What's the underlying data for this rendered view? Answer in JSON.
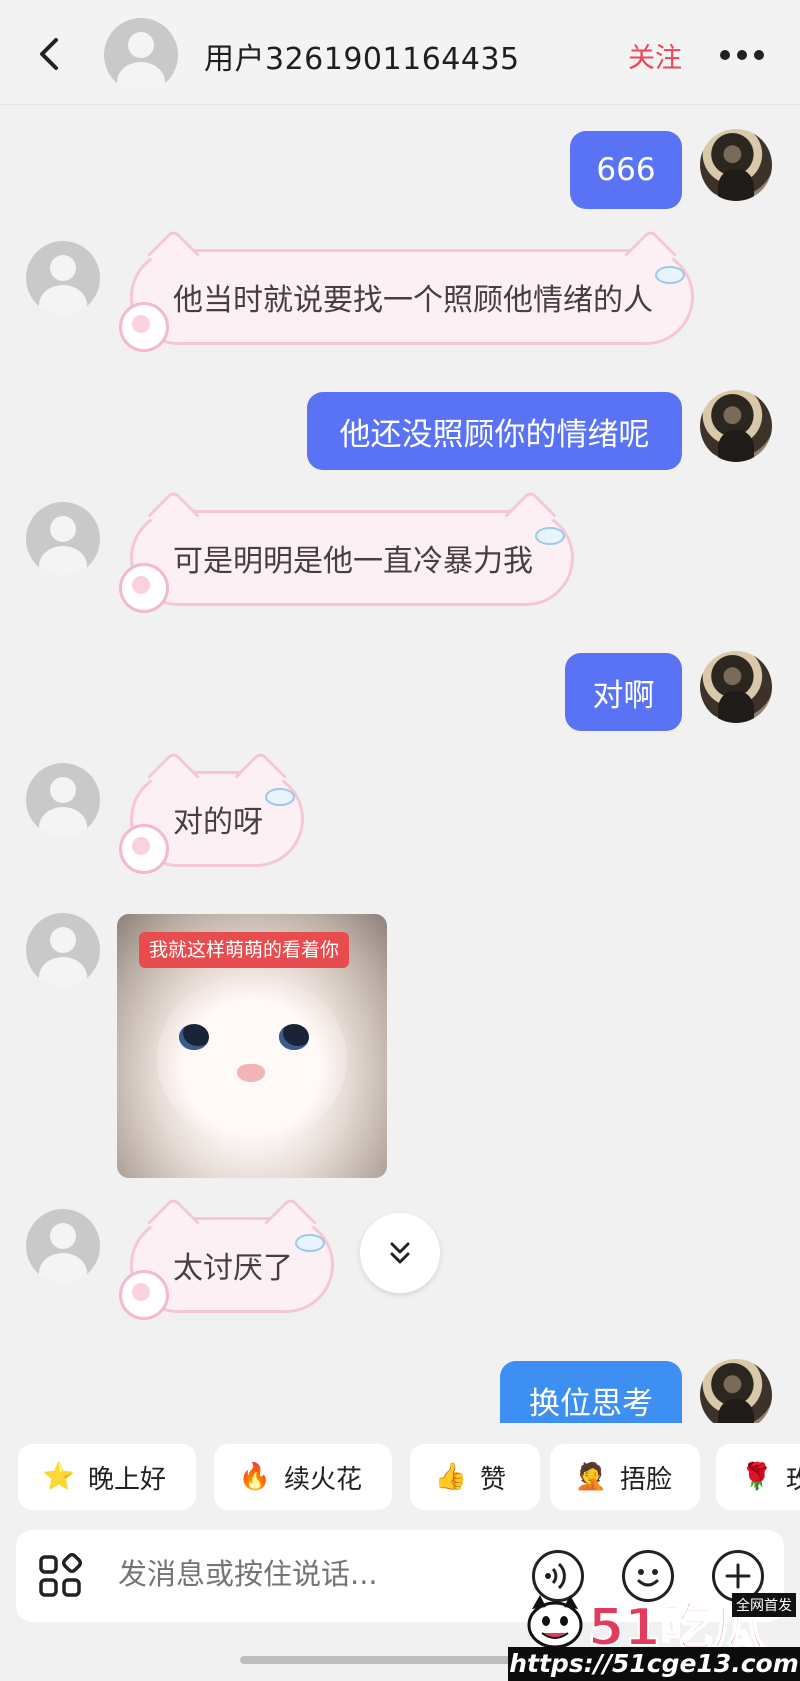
{
  "header": {
    "back_icon": "chevron-left-icon",
    "user_name": "用户3261901164435",
    "follow_label": "关注",
    "more_icon": "more-dots-icon"
  },
  "messages": [
    {
      "side": "self",
      "type": "text",
      "text": "666"
    },
    {
      "side": "other",
      "type": "text",
      "text": "他当时就说要找一个照顾他情绪的人"
    },
    {
      "side": "self",
      "type": "text",
      "text": "他还没照顾你的情绪呢"
    },
    {
      "side": "other",
      "type": "text",
      "text": "可是明明是他一直冷暴力我"
    },
    {
      "side": "self",
      "type": "text",
      "text": "对啊"
    },
    {
      "side": "other",
      "type": "text",
      "text": "对的呀"
    },
    {
      "side": "other",
      "type": "sticker",
      "caption": "我就这样萌萌的看着你"
    },
    {
      "side": "other",
      "type": "text",
      "text": "太讨厌了"
    },
    {
      "side": "self",
      "type": "text",
      "text": "换位思考"
    }
  ],
  "quick_replies": [
    {
      "icon": "star-face-icon",
      "emoji": "⭐",
      "label": "晚上好"
    },
    {
      "icon": "fire-icon",
      "emoji": "🔥",
      "label": "续火花"
    },
    {
      "icon": "thumbs-up-icon",
      "emoji": "👍",
      "label": "赞"
    },
    {
      "icon": "facepalm-icon",
      "emoji": "🤦",
      "label": "捂脸"
    },
    {
      "icon": "rose-icon",
      "emoji": "🌹",
      "label": "玫"
    }
  ],
  "input": {
    "placeholder": "发消息或按住说话...",
    "apps_icon": "apps-grid-icon",
    "voice_icon": "voice-icon",
    "emoji_icon": "emoji-icon",
    "plus_icon": "plus-icon"
  },
  "watermark": {
    "title": "51吃瓜",
    "tag": "全网首发",
    "url": "https://51cge13.com"
  },
  "colors": {
    "background": "#f1f1f1",
    "self_bubble": "#5a73f5",
    "follow": "#f0435a",
    "cat_bubble_fill": "#fdf0f5",
    "cat_bubble_border": "#f4c7d6"
  }
}
